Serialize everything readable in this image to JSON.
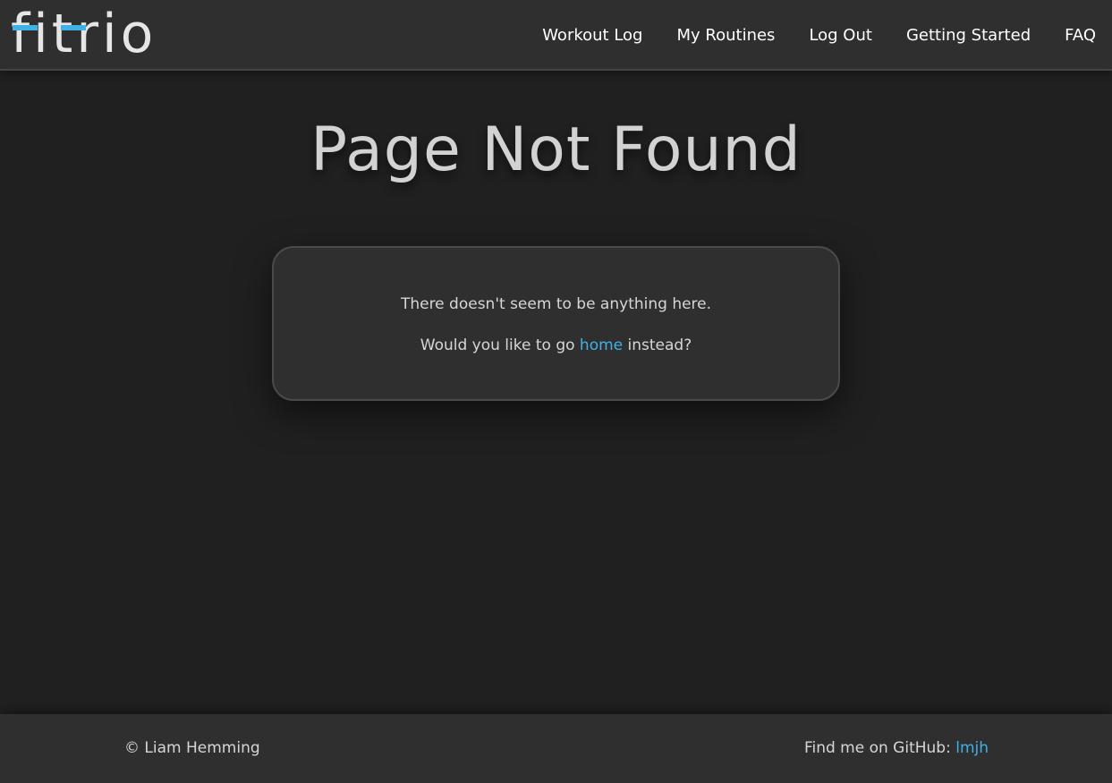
{
  "header": {
    "logo_text": "fitrio",
    "nav": [
      {
        "label": "Workout Log"
      },
      {
        "label": "My Routines"
      },
      {
        "label": "Log Out"
      },
      {
        "label": "Getting Started"
      },
      {
        "label": "FAQ"
      }
    ]
  },
  "main": {
    "title": "Page Not Found",
    "message_line1": "There doesn't seem to be anything here.",
    "message_line2_prefix": "Would you like to go ",
    "message_line2_link": "home",
    "message_line2_suffix": " instead?"
  },
  "footer": {
    "copyright": "© Liam Hemming",
    "github_prefix": "Find me on GitHub: ",
    "github_link": "lmjh"
  },
  "colors": {
    "background": "#202020",
    "header_bg": "#2f2f2f",
    "accent": "#3fb1e6",
    "text": "#d6d6d6"
  }
}
